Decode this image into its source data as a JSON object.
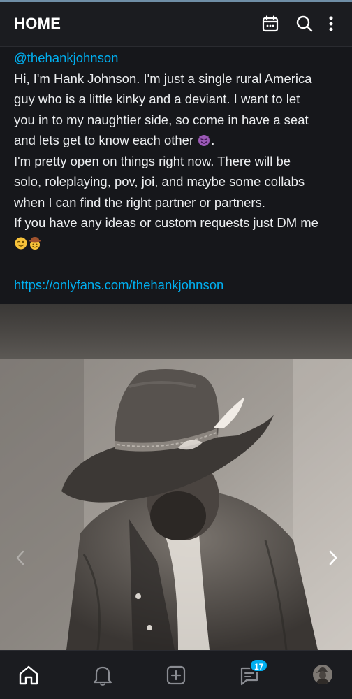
{
  "header": {
    "title": "HOME",
    "icons": [
      "calendar-icon",
      "search-icon",
      "more-vertical-icon"
    ]
  },
  "post": {
    "handle": "@thehankjohnson",
    "lines": [
      "Hi, I'm Hank Johnson. I'm just a single rural America",
      "guy who is a little kinky and a deviant. I want to let",
      "you in to my naughtier side, so come in have a seat",
      "and lets get to know each other",
      "I'm pretty open on things right now. There will be",
      "solo, roleplaying, pov, joi, and maybe some collabs",
      "when I can find the right partner or partners.",
      "If you have any ideas or custom requests just DM me"
    ],
    "line4_suffix": ".",
    "emojis": [
      "smiling-devil-emoji",
      "winking-face-emoji",
      "cowboy-face-emoji"
    ],
    "link": "https://onlyfans.com/thehankjohnson"
  },
  "media": {
    "description_icon": "photo",
    "prev_icon": "chevron-left-icon",
    "next_icon": "chevron-right-icon"
  },
  "bottom_nav": {
    "items": [
      "home-icon",
      "bell-icon",
      "add-post-icon",
      "messages-icon",
      "avatar"
    ],
    "messages_badge": "17"
  },
  "colors": {
    "accent": "#00aff0",
    "background": "#16171b",
    "bar": "#1b1c20"
  }
}
